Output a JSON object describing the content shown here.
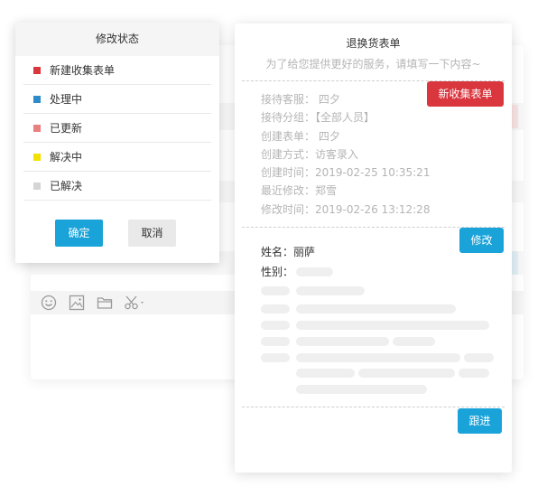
{
  "status_popup": {
    "title": "修改状态",
    "items": [
      {
        "label": "新建收集表单",
        "color": "#d9363e"
      },
      {
        "label": "处理中",
        "color": "#2e8bc9"
      },
      {
        "label": "已更新",
        "color": "#e88080"
      },
      {
        "label": "解决中",
        "color": "#f5e100"
      },
      {
        "label": "已解决",
        "color": "#d5d5d5"
      }
    ],
    "confirm_label": "确定",
    "cancel_label": "取消"
  },
  "form": {
    "title": "退换货表单",
    "subtitle": "为了给您提供更好的服务，请填写一下内容~",
    "new_button": "新收集表单",
    "edit_button": "修改",
    "follow_button": "跟进",
    "meta": [
      "接待客服：  四夕",
      "接待分组：【全部人员】",
      "创建表单：  四夕",
      "创建方式：访客录入",
      "创建时间：2019-02-25  10:35:21",
      "最近修改：郑雪",
      "修改时间：2019-02-26  13:12:28"
    ],
    "name_field": "姓名：丽萨",
    "gender_field": "性别："
  },
  "colors": {
    "accent_blue": "#1aa3d9",
    "accent_red": "#d9363e"
  },
  "toolbar_icons": [
    "smiley-icon",
    "image-icon",
    "folder-icon",
    "scissors-icon"
  ]
}
